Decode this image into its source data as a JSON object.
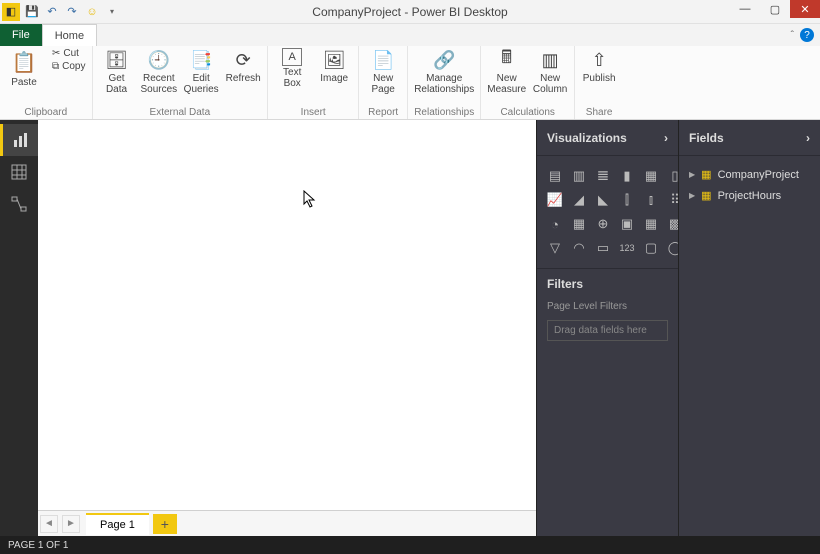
{
  "titlebar": {
    "title": "CompanyProject - Power BI Desktop"
  },
  "tabs": {
    "file": "File",
    "home": "Home"
  },
  "ribbon": {
    "clipboard": {
      "paste": "Paste",
      "cut": "Cut",
      "copy": "Copy",
      "label": "Clipboard"
    },
    "external": {
      "getdata": "Get\nData",
      "recent": "Recent\nSources",
      "edit": "Edit\nQueries",
      "refresh": "Refresh",
      "label": "External Data"
    },
    "insert": {
      "textbox": "Text\nBox",
      "image": "Image",
      "label": "Insert"
    },
    "report": {
      "newpage": "New\nPage",
      "label": "Report"
    },
    "relationships": {
      "manage": "Manage\nRelationships",
      "label": "Relationships"
    },
    "calculations": {
      "measure": "New\nMeasure",
      "column": "New\nColumn",
      "label": "Calculations"
    },
    "share": {
      "publish": "Publish",
      "label": "Share"
    }
  },
  "panels": {
    "viz": {
      "title": "Visualizations"
    },
    "filters": {
      "title": "Filters",
      "sub": "Page Level Filters",
      "placeholder": "Drag data fields here"
    },
    "fields": {
      "title": "Fields",
      "items": [
        "CompanyProject",
        "ProjectHours"
      ]
    }
  },
  "pagetabs": {
    "page1": "Page 1"
  },
  "status": "PAGE 1 OF 1"
}
